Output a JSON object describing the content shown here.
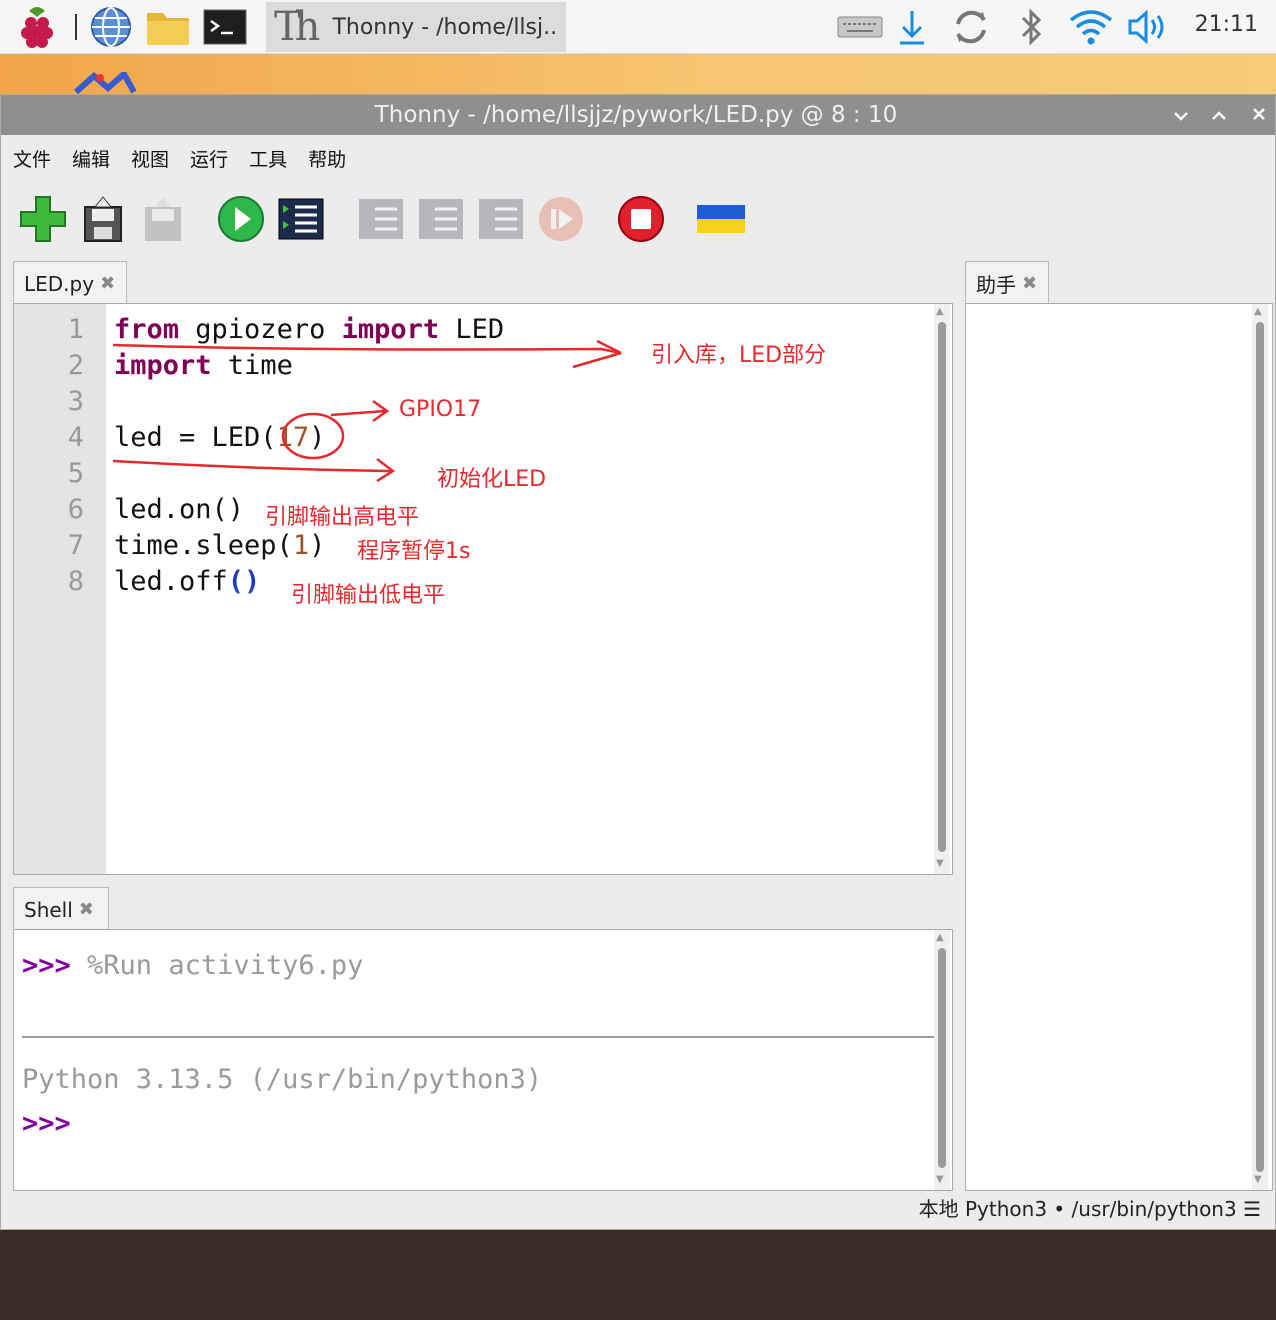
{
  "taskbar": {
    "task_title": "Thonny  -  /home/llsj..",
    "clock": "21:11",
    "colors": {
      "wifi": "#1a8ce0",
      "download": "#1a8ce0"
    }
  },
  "window": {
    "title": "Thonny  -  /home/llsjjz/pywork/LED.py  @  8 : 10",
    "menu": [
      "文件",
      "编辑",
      "视图",
      "运行",
      "工具",
      "帮助"
    ],
    "toolbar_icons": [
      "new-file-icon",
      "save-icon",
      "save-as-icon",
      "run-icon",
      "debug-icon",
      "step-over-icon",
      "step-into-icon",
      "step-out-icon",
      "resume-icon",
      "stop-icon",
      "ukraine-flag-icon"
    ]
  },
  "editor": {
    "tab_label": "LED.py",
    "lines": [
      {
        "n": "1"
      },
      {
        "n": "2"
      },
      {
        "n": "3"
      },
      {
        "n": "4"
      },
      {
        "n": "5"
      },
      {
        "n": "6"
      },
      {
        "n": "7"
      },
      {
        "n": "8"
      }
    ],
    "code": {
      "l1_kw1": "from",
      "l1_mid": " gpiozero ",
      "l1_kw2": "import",
      "l1_end": " LED",
      "l2_kw": "import",
      "l2_end": " time",
      "l4_a": "led = LED(",
      "l4_num": "17",
      "l4_b": ")",
      "l6": "led.on()",
      "l7_a": "time.sleep(",
      "l7_num": "1",
      "l7_b": ")",
      "l8_a": "led.off",
      "l8_paren": "()"
    }
  },
  "annotations": {
    "a1": "引入库，LED部分",
    "a2": "GPIO17",
    "a3": "初始化LED",
    "a4": "引脚输出高电平",
    "a5": "程序暂停1s",
    "a6": "引脚输出低电平"
  },
  "assistant": {
    "tab_label": "助手"
  },
  "shell": {
    "tab_label": "Shell",
    "prompt": ">>>",
    "run_cmd": " %Run activity6.py",
    "python_info": "Python 3.13.5 (/usr/bin/python3)"
  },
  "status": {
    "interpreter": "本地 Python3  •  /usr/bin/python3  ☰"
  }
}
